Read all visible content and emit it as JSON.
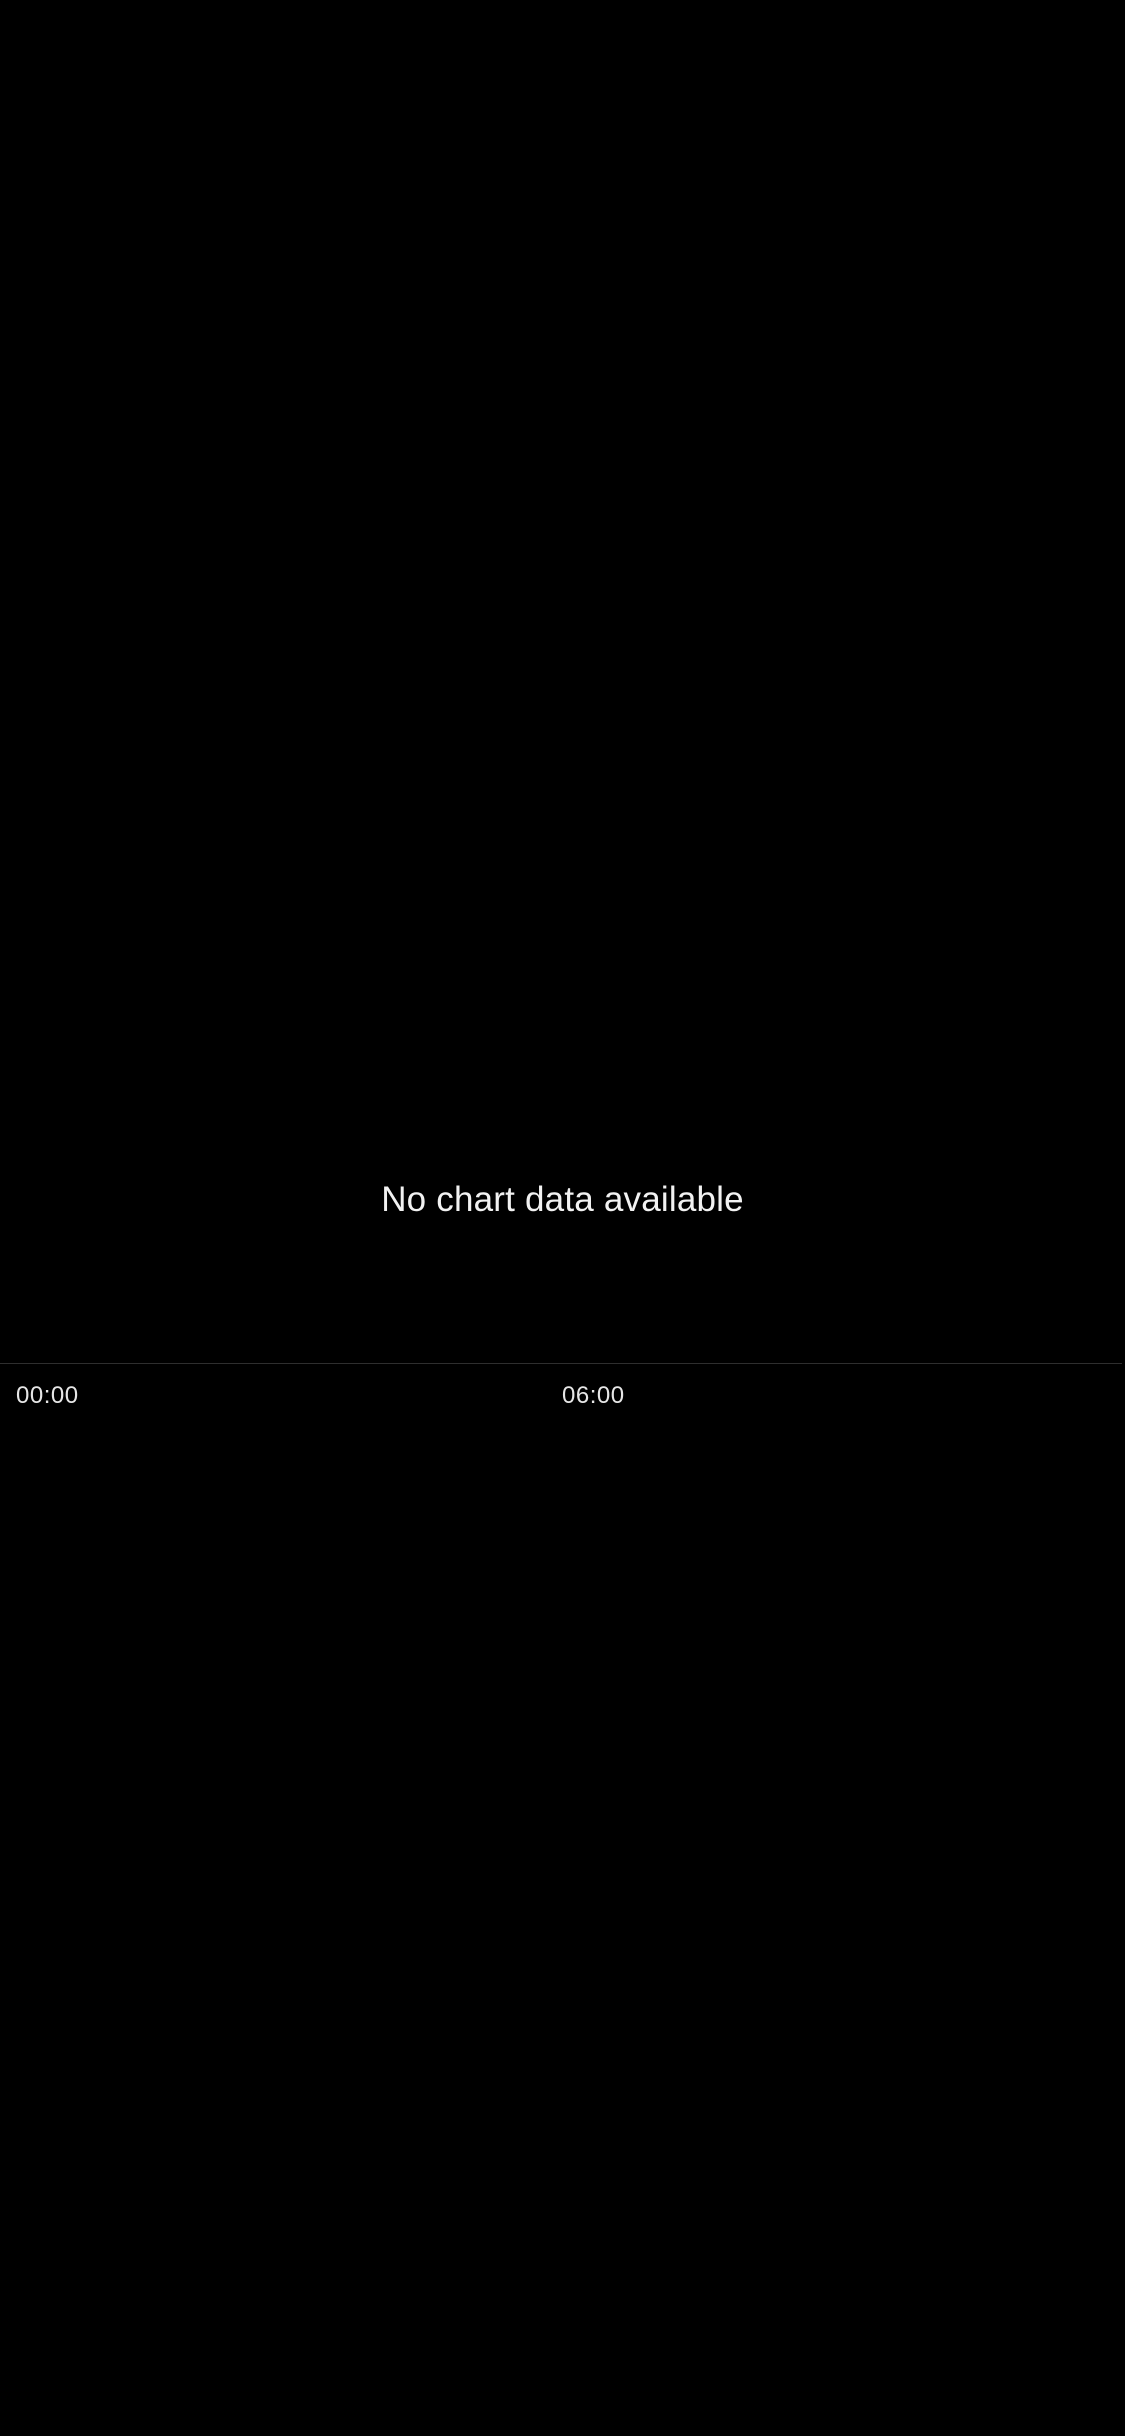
{
  "chart": {
    "empty_message": "No chart data available",
    "x_ticks": [
      "00:00",
      "06:00"
    ]
  },
  "colors": {
    "background": "#000000",
    "text": "#ffffff",
    "axis_line": "#2e2e2e"
  },
  "chart_data": {
    "type": "line",
    "title": "",
    "xlabel": "",
    "ylabel": "",
    "x_tick_labels": [
      "00:00",
      "06:00"
    ],
    "series": [],
    "annotations": [
      "No chart data available"
    ],
    "grid": false
  }
}
